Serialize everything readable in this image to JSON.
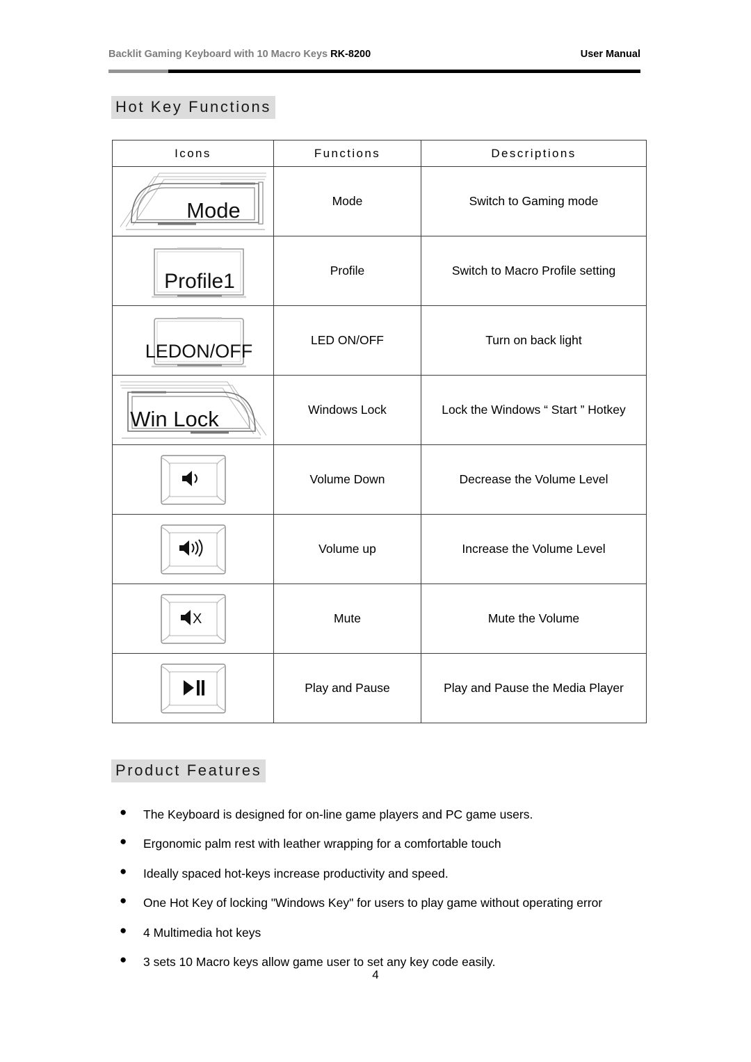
{
  "header": {
    "title_main": "Backlit Gaming Keyboard with 10 Macro Keys ",
    "model": "RK-8200",
    "right_label": "User Manual"
  },
  "sections": {
    "hotkey_heading": "Hot Key Functions",
    "features_heading": "Product Features"
  },
  "table": {
    "columns": [
      "Icons",
      "Functions",
      "Descriptions"
    ],
    "rows": [
      {
        "icon_name": "mode-key-icon",
        "icon_label": "Mode",
        "icon_style": "wide-left-angled",
        "function": "Mode",
        "description": "Switch to Gaming mode"
      },
      {
        "icon_name": "profile1-key-icon",
        "icon_label": "Profile1",
        "icon_style": "plain-wide",
        "function": "Profile",
        "description": "Switch to Macro Profile setting"
      },
      {
        "icon_name": "led-on-off-key-icon",
        "icon_label": "LEDON/OFF",
        "icon_style": "plain-wide",
        "function": "LED ON/OFF",
        "description": "Turn on back light"
      },
      {
        "icon_name": "win-lock-key-icon",
        "icon_label": "Win Lock",
        "icon_style": "wide-right-angled",
        "function": "Windows Lock",
        "description": "Lock the Windows “ Start ” Hotkey"
      },
      {
        "icon_name": "volume-down-key-icon",
        "icon_label": "",
        "icon_style": "keycap-volume-down",
        "function": "Volume Down",
        "description": "Decrease the Volume Level"
      },
      {
        "icon_name": "volume-up-key-icon",
        "icon_label": "",
        "icon_style": "keycap-volume-up",
        "function": "Volume up",
        "description": "Increase the Volume Level"
      },
      {
        "icon_name": "mute-key-icon",
        "icon_label": "",
        "icon_style": "keycap-mute",
        "function": "Mute",
        "description": "Mute the Volume"
      },
      {
        "icon_name": "play-pause-key-icon",
        "icon_label": "",
        "icon_style": "keycap-play-pause",
        "function": "Play and Pause",
        "description": "Play and Pause the Media Player"
      }
    ]
  },
  "features": {
    "bullet_glyph": "●",
    "items": [
      {
        "text": "The Keyboard is designed for on-line game players and PC game users.",
        "justify": false
      },
      {
        "text": "Ergonomic palm rest with leather wrapping for a comfortable touch",
        "justify": false
      },
      {
        "text": "Ideally spaced hot-keys increase productivity and speed.",
        "justify": false
      },
      {
        "text": "One Hot Key of locking \"Windows Key\" for users to play game without operating error",
        "justify": true
      },
      {
        "text": "4 Multimedia hot keys",
        "justify": false
      },
      {
        "text": "3 sets 10 Macro keys allow game user to set any key code easily.",
        "justify": false
      }
    ]
  },
  "footer": {
    "page_number": "4"
  },
  "colors": {
    "rule_gray": "#949494",
    "rule_black": "#000000",
    "heading_highlight": "#dcdcdc",
    "header_text_gray": "#7d7d7d",
    "table_border": "#3a3a3a"
  }
}
